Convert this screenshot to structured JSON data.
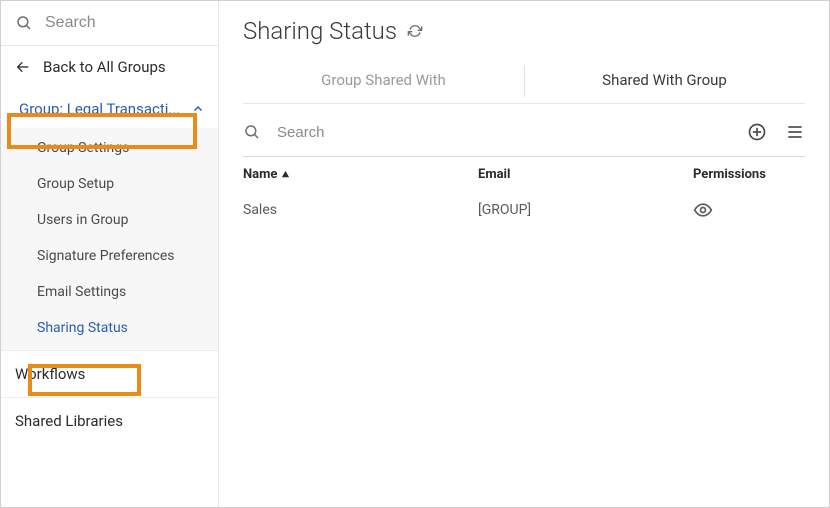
{
  "sidebar": {
    "search_placeholder": "Search",
    "back_label": "Back to All Groups",
    "group_label": "Group: Legal Transacti...",
    "items": [
      {
        "label": "Group Settings"
      },
      {
        "label": "Group Setup"
      },
      {
        "label": "Users in Group"
      },
      {
        "label": "Signature Preferences"
      },
      {
        "label": "Email Settings"
      },
      {
        "label": "Sharing Status"
      }
    ],
    "workflows_label": "Workflows",
    "shared_libraries_label": "Shared Libraries"
  },
  "page": {
    "title": "Sharing Status",
    "tabs": [
      {
        "label": "Group Shared With"
      },
      {
        "label": "Shared With Group"
      }
    ],
    "table_search_placeholder": "Search",
    "columns": {
      "name": "Name",
      "email": "Email",
      "permissions": "Permissions"
    },
    "rows": [
      {
        "name": "Sales",
        "email": "[GROUP]"
      }
    ]
  }
}
